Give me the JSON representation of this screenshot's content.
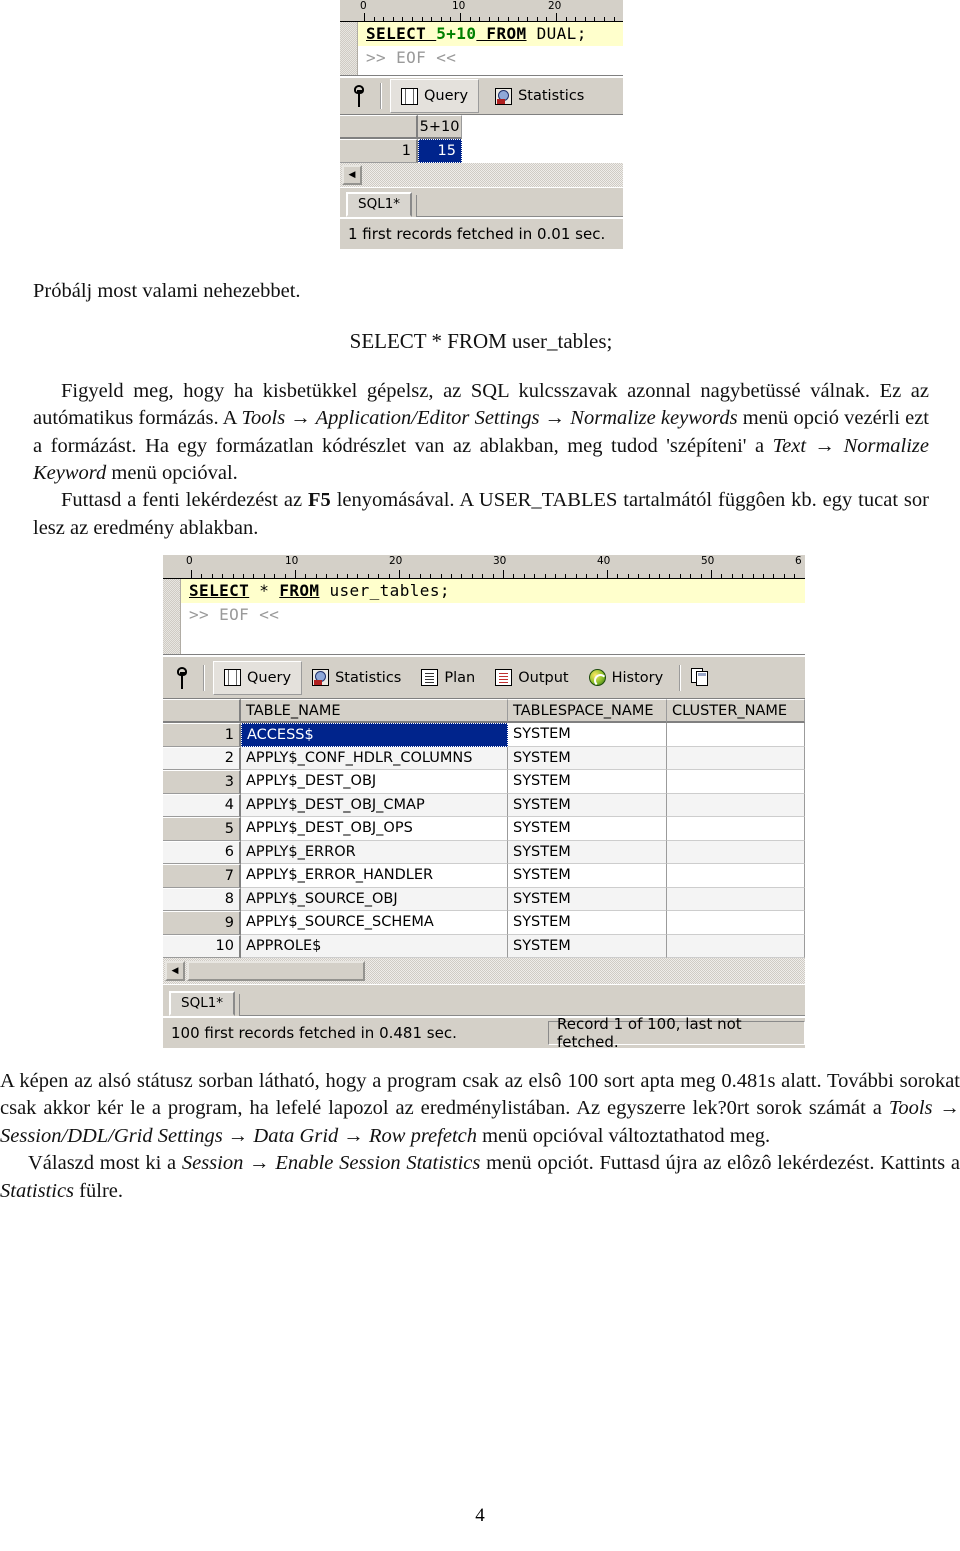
{
  "page": {
    "number": "4"
  },
  "screenshot1": {
    "name": "pl-sql-developer-dual-query",
    "ruler_labels": [
      "0",
      "10",
      "20"
    ],
    "editor": {
      "line1_prefix": "SELECT ",
      "line1_literal": "5+10",
      "line1_mid": " FROM",
      "line1_suffix": " DUAL;",
      "line2": ">> EOF <<"
    },
    "tabs": [
      {
        "label": "Query",
        "icon": "grid-icon",
        "active": true
      },
      {
        "label": "Statistics",
        "icon": "statistics-clock-icon",
        "active": false
      }
    ],
    "grid": {
      "columns": [
        "",
        "5+10"
      ],
      "rows": [
        {
          "num": "1",
          "cells": [
            "15"
          ]
        }
      ]
    },
    "sheet_tab": "SQL1*",
    "status": {
      "left": "1 first records fetched in 0.01 sec.",
      "right": ""
    }
  },
  "paragraphs": {
    "p1": "Próbálj most valami nehezebbet.",
    "query_centered": "SELECT * FROM user_tables;",
    "p2_a": "Figyeld meg, hogy ha kisbetükkel gépelsz, az SQL kulcsszavak azonnal nagybetüssé válnak. Ez az autómatikus formázás. A ",
    "p2_menu1": "Tools → Application/Editor Settings → Normalize keywords",
    "p2_b": " menü opció vezérli ezt a formázást. Ha egy formázatlan kódrészlet van az ablakban, meg tudod 'szépíteni' a ",
    "p2_menu2": "Text → Normalize Keyword",
    "p2_c": " menü opcióval.",
    "p3_a": "Futtasd a fenti lekérdezést az ",
    "p3_key": "F5",
    "p3_b": " lenyomásával. A USER_TABLES tartalmától függôen kb. egy tucat sor lesz az eredmény ablakban.",
    "p4_a": "A képen az alsó státusz sorban látható, hogy a program csak az elsô 100 sort apta meg 0.481s alatt. További sorokat csak akkor kér le a program, ha lefelé lapozol az eredménylistában. Az egyszerre lek?0rt sorok számát a ",
    "p4_menu": "Tools → Session/DDL/Grid Settings → Data Grid → Row prefetch",
    "p4_b": " menü opcióval változtathatod meg.",
    "p5_a": "Válaszd most ki a ",
    "p5_menu": "Session → Enable Session Statistics",
    "p5_b": " menü opciót. Futtasd újra az elôzô lekérdezést. Kattints a ",
    "p5_tab": "Statistics",
    "p5_c": " fülre."
  },
  "screenshot2": {
    "name": "pl-sql-developer-user-tables-query",
    "ruler_labels": [
      "0",
      "10",
      "20",
      "30",
      "40",
      "50",
      "6"
    ],
    "editor": {
      "line1_a": "SELECT",
      "line1_b": " * ",
      "line1_c": "FROM",
      "line1_d": " user_tables;",
      "line2": ">> EOF <<"
    },
    "tabs": [
      {
        "label": "Query",
        "icon": "grid-icon",
        "active": true
      },
      {
        "label": "Statistics",
        "icon": "statistics-clock-icon",
        "active": false
      },
      {
        "label": "Plan",
        "icon": "plan-document-icon",
        "active": false
      },
      {
        "label": "Output",
        "icon": "output-document-icon",
        "active": false
      },
      {
        "label": "History",
        "icon": "history-globe-icon",
        "active": false
      }
    ],
    "grid": {
      "columns": [
        "TABLE_NAME",
        "TABLESPACE_NAME",
        "CLUSTER_NAME"
      ],
      "rows": [
        {
          "num": "1",
          "table_name": "ACCESS$",
          "tablespace_name": "SYSTEM",
          "cluster_name": "",
          "selected": true
        },
        {
          "num": "2",
          "table_name": "APPLY$_CONF_HDLR_COLUMNS",
          "tablespace_name": "SYSTEM",
          "cluster_name": "",
          "selected": false
        },
        {
          "num": "3",
          "table_name": "APPLY$_DEST_OBJ",
          "tablespace_name": "SYSTEM",
          "cluster_name": "",
          "selected": false
        },
        {
          "num": "4",
          "table_name": "APPLY$_DEST_OBJ_CMAP",
          "tablespace_name": "SYSTEM",
          "cluster_name": "",
          "selected": false
        },
        {
          "num": "5",
          "table_name": "APPLY$_DEST_OBJ_OPS",
          "tablespace_name": "SYSTEM",
          "cluster_name": "",
          "selected": false
        },
        {
          "num": "6",
          "table_name": "APPLY$_ERROR",
          "tablespace_name": "SYSTEM",
          "cluster_name": "",
          "selected": false
        },
        {
          "num": "7",
          "table_name": "APPLY$_ERROR_HANDLER",
          "tablespace_name": "SYSTEM",
          "cluster_name": "",
          "selected": false
        },
        {
          "num": "8",
          "table_name": "APPLY$_SOURCE_OBJ",
          "tablespace_name": "SYSTEM",
          "cluster_name": "",
          "selected": false
        },
        {
          "num": "9",
          "table_name": "APPLY$_SOURCE_SCHEMA",
          "tablespace_name": "SYSTEM",
          "cluster_name": "",
          "selected": false
        },
        {
          "num": "10",
          "table_name": "APPROLE$",
          "tablespace_name": "SYSTEM",
          "cluster_name": "",
          "selected": false
        }
      ]
    },
    "sheet_tab": "SQL1*",
    "status": {
      "left": "100 first records fetched in 0.481 sec.",
      "right": "Record 1 of 100, last not fetched."
    }
  },
  "colors": {
    "window_face": "#d4d0c8",
    "code_highlight": "#ffffcc",
    "selection": "#00248c",
    "keyword_literal": "#008000"
  }
}
